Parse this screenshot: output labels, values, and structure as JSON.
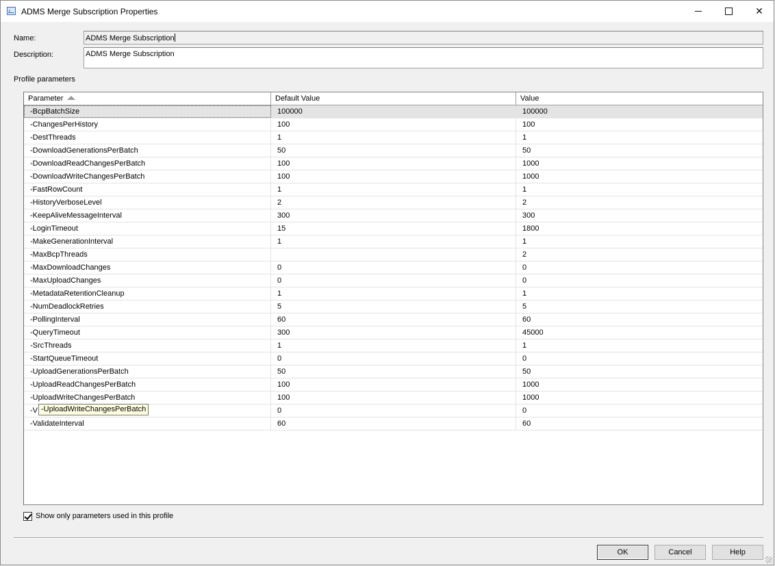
{
  "window": {
    "title": "ADMS Merge Subscription Properties",
    "controls": {
      "minimize": "minimize",
      "maximize": "maximize",
      "close": "✕"
    }
  },
  "form": {
    "name_label": "Name:",
    "name_value": "ADMS Merge Subscription",
    "description_label": "Description:",
    "description_value": "ADMS Merge Subscription",
    "profile_parameters_label": "Profile parameters"
  },
  "grid": {
    "columns": [
      "Parameter",
      "Default Value",
      "Value"
    ],
    "sorted_column": "Parameter",
    "selected_row": 0,
    "rows": [
      [
        "-BcpBatchSize",
        "100000",
        "100000"
      ],
      [
        "-ChangesPerHistory",
        "100",
        "100"
      ],
      [
        "-DestThreads",
        "1",
        "1"
      ],
      [
        "-DownloadGenerationsPerBatch",
        "50",
        "50"
      ],
      [
        "-DownloadReadChangesPerBatch",
        "100",
        "1000"
      ],
      [
        "-DownloadWriteChangesPerBatch",
        "100",
        "1000"
      ],
      [
        "-FastRowCount",
        "1",
        "1"
      ],
      [
        "-HistoryVerboseLevel",
        "2",
        "2"
      ],
      [
        "-KeepAliveMessageInterval",
        "300",
        "300"
      ],
      [
        "-LoginTimeout",
        "15",
        "1800"
      ],
      [
        "-MakeGenerationInterval",
        "1",
        "1"
      ],
      [
        "-MaxBcpThreads",
        "",
        "2"
      ],
      [
        "-MaxDownloadChanges",
        "0",
        "0"
      ],
      [
        "-MaxUploadChanges",
        "0",
        "0"
      ],
      [
        "-MetadataRetentionCleanup",
        "1",
        "1"
      ],
      [
        "-NumDeadlockRetries",
        "5",
        "5"
      ],
      [
        "-PollingInterval",
        "60",
        "60"
      ],
      [
        "-QueryTimeout",
        "300",
        "45000"
      ],
      [
        "-SrcThreads",
        "1",
        "1"
      ],
      [
        "-StartQueueTimeout",
        "0",
        "0"
      ],
      [
        "-UploadGenerationsPerBatch",
        "50",
        "50"
      ],
      [
        "-UploadReadChangesPerBatch",
        "100",
        "1000"
      ],
      [
        "-UploadWriteChangesPerBatch",
        "100",
        "1000"
      ],
      [
        "-V",
        "0",
        "0"
      ],
      [
        "-ValidateInterval",
        "60",
        "60"
      ]
    ],
    "tooltip": "-UploadWriteChangesPerBatch"
  },
  "options": {
    "show_only_used_label": "Show only parameters used in this profile",
    "show_only_used_checked": true
  },
  "buttons": {
    "ok": "OK",
    "cancel": "Cancel",
    "help": "Help"
  }
}
